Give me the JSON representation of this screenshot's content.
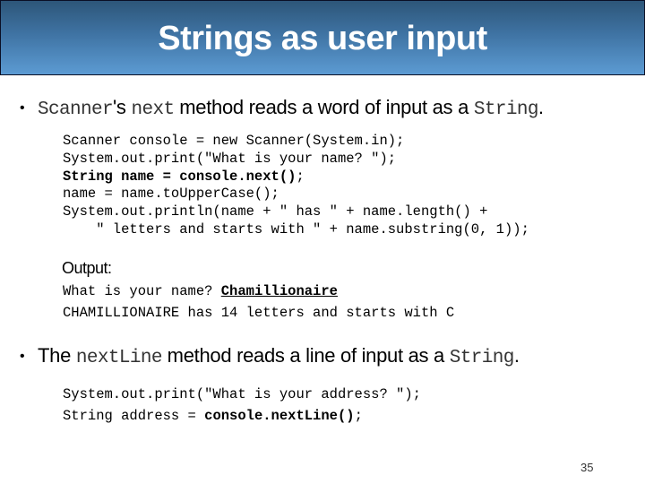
{
  "slide": {
    "title": "Strings as user input",
    "page_number": "35",
    "colors": {
      "title_bar_top": "#2d5679",
      "title_bar_bottom": "#5c9bd3",
      "title_text": "#ffffff"
    }
  },
  "bullets": [
    {
      "marker": "•",
      "parts": [
        {
          "text": "Scanner",
          "style": "mono"
        },
        {
          "text": "'s ",
          "style": "text"
        },
        {
          "text": "next",
          "style": "mono"
        },
        {
          "text": " method reads a word of input as a ",
          "style": "text"
        },
        {
          "text": "String",
          "style": "mono"
        },
        {
          "text": ".",
          "style": "text"
        }
      ]
    },
    {
      "marker": "•",
      "parts": [
        {
          "text": "The ",
          "style": "text"
        },
        {
          "text": "nextLine",
          "style": "mono"
        },
        {
          "text": " method reads a line of input as a ",
          "style": "text"
        },
        {
          "text": "String",
          "style": "mono"
        },
        {
          "text": ".",
          "style": "text"
        }
      ]
    }
  ],
  "code1": [
    [
      {
        "t": "Scanner console = new Scanner(System.in);"
      }
    ],
    [
      {
        "t": "System.out.print(\"What is your name? \");"
      }
    ],
    [
      {
        "t": "String name = console.next()",
        "b": true
      },
      {
        "t": ";"
      }
    ],
    [
      {
        "t": "name = name.toUpperCase();"
      }
    ],
    [
      {
        "t": "System.out.println(name + \" has \" + name.length() +"
      }
    ],
    [
      {
        "t": "    \" letters and starts with \" + name.substring(0, 1));"
      }
    ]
  ],
  "output": {
    "label": "Output:",
    "lines": [
      [
        {
          "t": "What is your name? "
        },
        {
          "t": "Chamillionaire",
          "u": true
        }
      ],
      [
        {
          "t": "CHAMILLIONAIRE has 14 letters and starts with C"
        }
      ]
    ]
  },
  "code2": [
    [
      {
        "t": "System.out.print(\"What is your address? \");"
      }
    ],
    [
      {
        "t": "String address = "
      },
      {
        "t": "console.nextLine()",
        "b": true
      },
      {
        "t": ";"
      }
    ]
  ]
}
